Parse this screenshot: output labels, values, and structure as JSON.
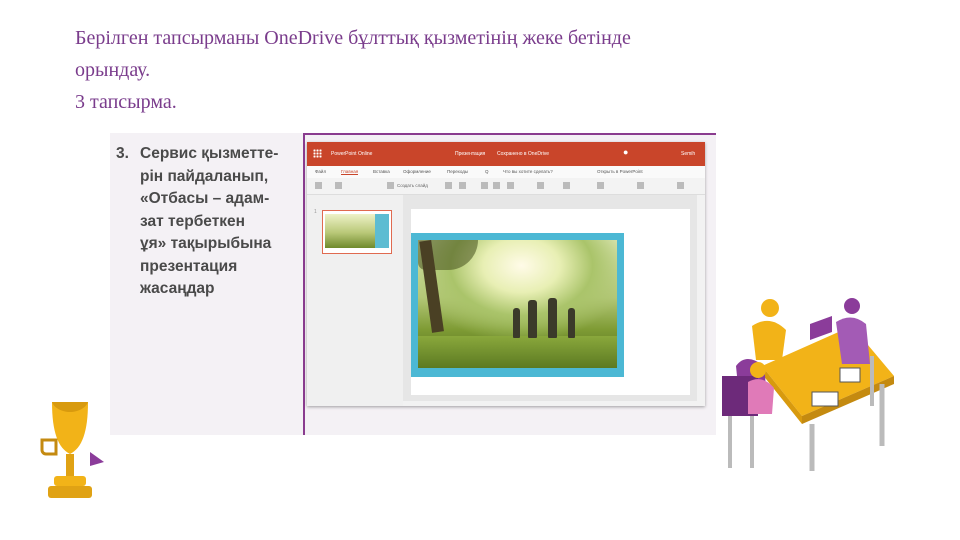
{
  "slide": {
    "heading_lines": [
      "Берілген тапсырманы  OneDrive бұлттық қызметінің жеке бетінде",
      "орындау.",
      "3 тапсырма."
    ]
  },
  "textbook": {
    "task_number": "3.",
    "task_lines": [
      "Сервис қызметте-",
      "рін пайдаланып,",
      "«Отбасы – адам-",
      "зат тербеткен",
      "ұя» тақырыбына",
      "презентация",
      "жасаңдар"
    ]
  },
  "ppt_window": {
    "app_title": "PowerPoint Online",
    "doc_name": "Презентация",
    "save_state": "Сохранено в OneDrive",
    "user": "Semih",
    "tabs": [
      "Файл",
      "Главная",
      "Вставка",
      "Оформление",
      "Переходы",
      "Q",
      "Что вы хотите сделать?",
      "Открыть в PowerPoint"
    ],
    "ribbon_label": "Создать слайд",
    "thumb_number": "1"
  },
  "colors": {
    "heading": "#7a3c8c",
    "ppt_titlebar": "#c9452a",
    "slide_frame": "#4cb8d4",
    "book_rule": "#8a3c8f",
    "trophy": "#f2b318",
    "people_purple": "#8b3c9a"
  }
}
